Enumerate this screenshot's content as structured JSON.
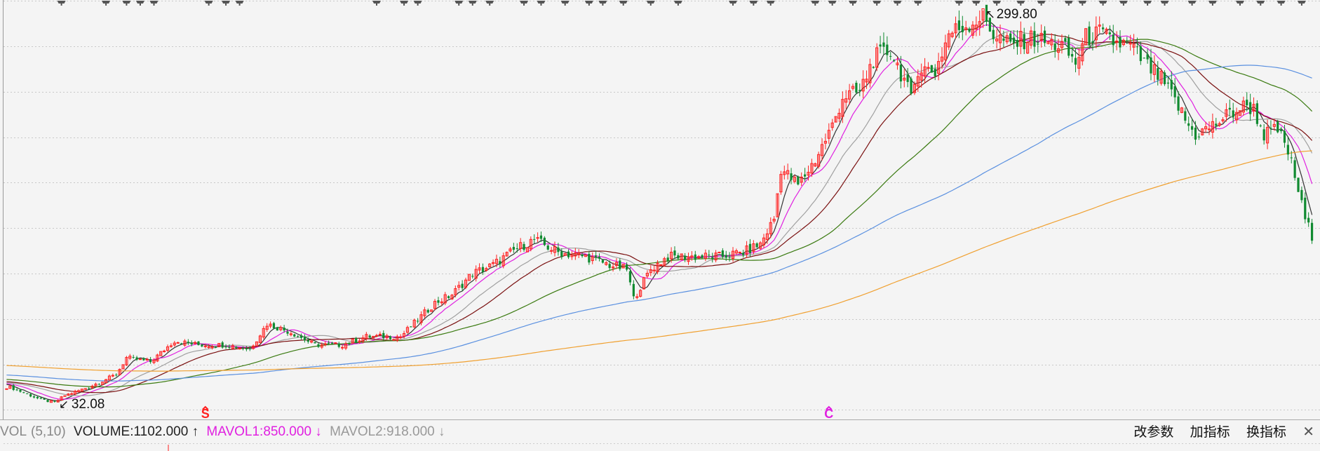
{
  "chart_data": {
    "type": "candlestick",
    "bar_count": 382,
    "close_keypoints": [
      [
        1,
        42.6
      ],
      [
        10,
        34.0
      ],
      [
        14,
        32.1
      ],
      [
        17,
        36.9
      ],
      [
        24,
        42.6
      ],
      [
        32,
        51.2
      ],
      [
        35,
        62.7
      ],
      [
        42,
        59.9
      ],
      [
        49,
        74.2
      ],
      [
        56,
        71.4
      ],
      [
        64,
        71.4
      ],
      [
        71,
        68.5
      ],
      [
        76,
        85.7
      ],
      [
        83,
        80.0
      ],
      [
        90,
        71.4
      ],
      [
        98,
        71.4
      ],
      [
        105,
        77.1
      ],
      [
        115,
        77.1
      ],
      [
        120,
        88.6
      ],
      [
        125,
        100.1
      ],
      [
        130,
        105.8
      ],
      [
        136,
        120.2
      ],
      [
        142,
        126.0
      ],
      [
        149,
        137.4
      ],
      [
        154,
        143.2
      ],
      [
        161,
        134.6
      ],
      [
        169,
        131.7
      ],
      [
        176,
        126.0
      ],
      [
        181,
        123.1
      ],
      [
        183,
        103.0
      ],
      [
        188,
        123.1
      ],
      [
        193,
        131.7
      ],
      [
        200,
        131.7
      ],
      [
        208,
        131.7
      ],
      [
        215,
        134.6
      ],
      [
        220,
        140.3
      ],
      [
        224,
        157.5
      ],
      [
        226,
        192.0
      ],
      [
        231,
        180.5
      ],
      [
        236,
        197.8
      ],
      [
        241,
        220.8
      ],
      [
        244,
        240.9
      ],
      [
        249,
        243.8
      ],
      [
        253,
        266.7
      ],
      [
        258,
        272.5
      ],
      [
        262,
        252.4
      ],
      [
        264,
        238.0
      ],
      [
        266,
        261.0
      ],
      [
        271,
        258.1
      ],
      [
        275,
        284.0
      ],
      [
        280,
        289.7
      ],
      [
        285,
        295.5
      ],
      [
        288,
        284.0
      ],
      [
        293,
        275.4
      ],
      [
        298,
        281.1
      ],
      [
        303,
        278.2
      ],
      [
        308,
        275.4
      ],
      [
        312,
        263.9
      ],
      [
        315,
        281.1
      ],
      [
        319,
        284.0
      ],
      [
        323,
        278.2
      ],
      [
        328,
        275.4
      ],
      [
        332,
        263.9
      ],
      [
        337,
        252.4
      ],
      [
        341,
        238.0
      ],
      [
        345,
        220.8
      ],
      [
        347,
        215.0
      ],
      [
        352,
        220.8
      ],
      [
        357,
        229.4
      ],
      [
        362,
        235.1
      ],
      [
        364,
        232.3
      ],
      [
        367,
        215.0
      ],
      [
        371,
        218.0
      ],
      [
        374,
        203.5
      ],
      [
        376,
        186.3
      ],
      [
        379,
        157.5
      ],
      [
        381,
        146.1
      ]
    ],
    "price_range": [
      32.08,
      299.8
    ],
    "high_label": "299.80",
    "low_label": "32.08",
    "high_bar": 284,
    "low_bar": 14,
    "moving_averages": [
      {
        "period": 5,
        "color": "#333333"
      },
      {
        "period": 10,
        "color": "#e020e0"
      },
      {
        "period": 20,
        "color": "#a0a0a0"
      },
      {
        "period": 30,
        "color": "#7a1010"
      },
      {
        "period": 60,
        "color": "#3a7a10"
      },
      {
        "period": 120,
        "color": "#5a90e0"
      },
      {
        "period": 250,
        "color": "#f0a030"
      }
    ],
    "up_color": "#ff2020",
    "down_color": "#108a30",
    "grid": true,
    "signal_markers": [
      {
        "label": "S",
        "bar": 58,
        "color": "#ff2020"
      },
      {
        "label": "C",
        "bar": 240,
        "color": "#e020e0"
      }
    ],
    "event_marker_bars": [
      16,
      29,
      35,
      39,
      43,
      59,
      64,
      68,
      108,
      116,
      120,
      132,
      136,
      141,
      151,
      156,
      163,
      170,
      174,
      180,
      188,
      196,
      212,
      218,
      223,
      236,
      241,
      247,
      254,
      260,
      266,
      278,
      283,
      289,
      296,
      302,
      310,
      314,
      320,
      326,
      333,
      338,
      346,
      352,
      360,
      366,
      372,
      378
    ]
  },
  "indicator_bar": {
    "name": "VOL",
    "params": "(5,10)",
    "volume": "VOLUME:1102.000 ↑",
    "mavol1": "MAVOL1:850.000 ↓",
    "mavol2": "MAVOL2:918.000 ↓",
    "buttons": [
      "改参数",
      "加指标",
      "换指标"
    ],
    "close": "✕"
  }
}
